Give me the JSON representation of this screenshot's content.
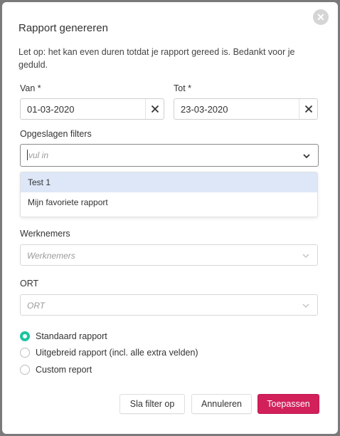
{
  "dialog": {
    "title": "Rapport genereren",
    "notice": "Let op: het kan even duren totdat je rapport gereed is. Bedankt voor je geduld."
  },
  "dates": {
    "from_label": "Van *",
    "from_value": "01-03-2020",
    "to_label": "Tot *",
    "to_value": "23-03-2020"
  },
  "saved_filters": {
    "label": "Opgeslagen filters",
    "placeholder": "vul in",
    "options": [
      "Test 1",
      "Mijn favoriete rapport"
    ]
  },
  "employees": {
    "label": "Werknemers",
    "placeholder": "Werknemers"
  },
  "ort": {
    "label": "ORT",
    "placeholder": "ORT"
  },
  "report_types": [
    {
      "label": "Standaard rapport",
      "selected": true
    },
    {
      "label": "Uitgebreid rapport (incl. alle extra velden)",
      "selected": false
    },
    {
      "label": "Custom report",
      "selected": false
    }
  ],
  "buttons": {
    "save_filter": "Sla filter op",
    "cancel": "Annuleren",
    "apply": "Toepassen"
  },
  "colors": {
    "primary": "#d1205a",
    "radio_selected": "#1cc4a0",
    "option_highlight": "#dde7f7"
  },
  "icons": {
    "close": "close-icon",
    "clear": "clear-icon",
    "dropdown": "chevron-down-icon"
  }
}
